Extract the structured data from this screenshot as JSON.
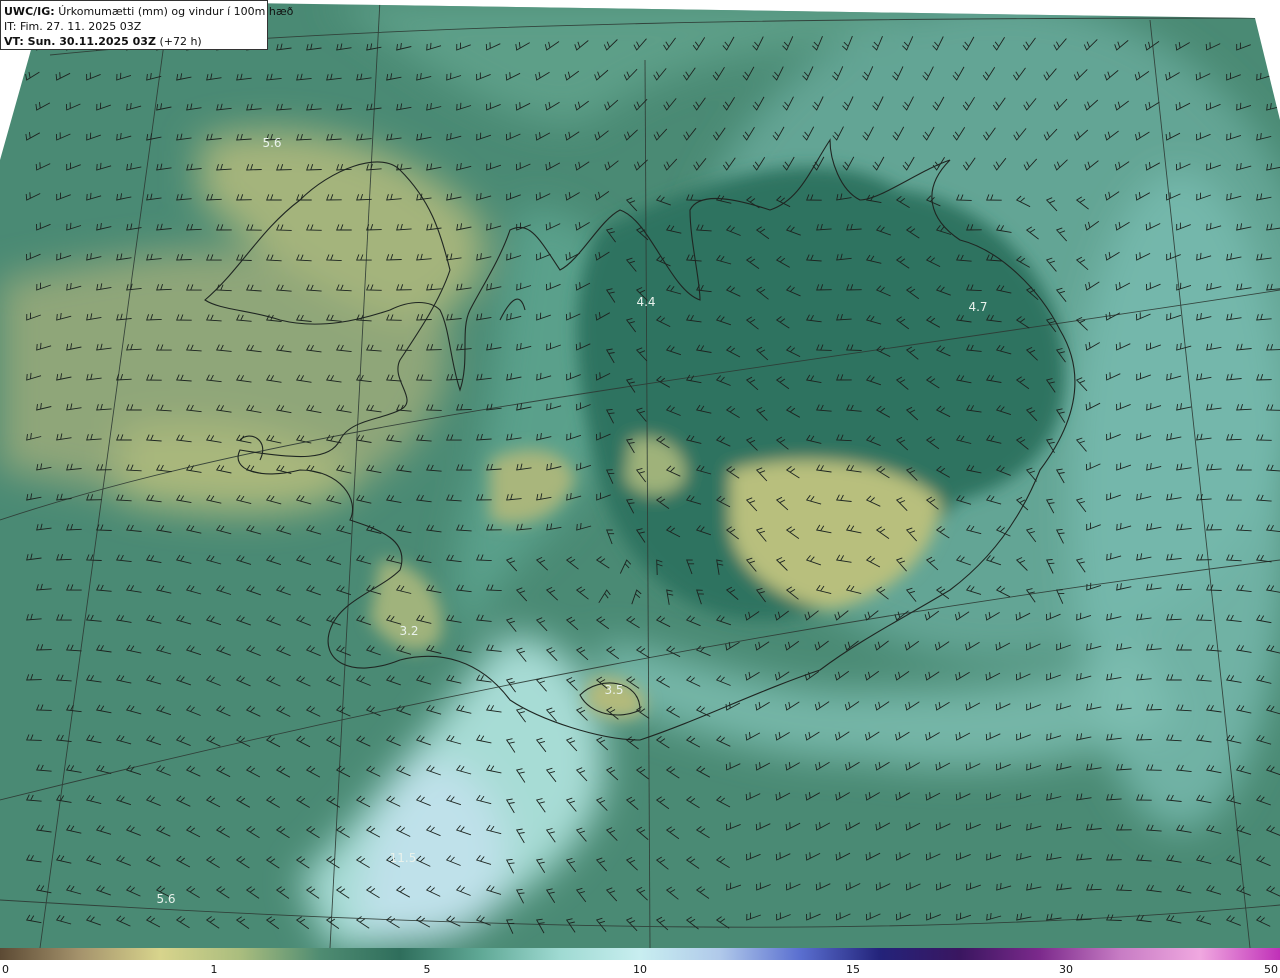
{
  "header": {
    "model": "UWC/IG:",
    "description": "Úrkomumætti (mm) og vindur í 100m hæð",
    "init_time": "IT: Fim. 27. 11. 2025 03Z",
    "valid_label": "VT: Sun. 30.11.2025 03Z",
    "lead_time": "(+72 h)"
  },
  "map_labels": [
    {
      "text": "5.6",
      "region": "northwest-sea"
    },
    {
      "text": "4.4",
      "region": "north-iceland"
    },
    {
      "text": "4.7",
      "region": "east-iceland"
    },
    {
      "text": "3.2",
      "region": "west-south-coast"
    },
    {
      "text": "3.5",
      "region": "south-coast"
    },
    {
      "text": "11.5",
      "region": "south-sea"
    },
    {
      "text": "5.6",
      "region": "southwest-sea"
    }
  ],
  "colorbar": {
    "ticks": [
      "0",
      "1",
      "5",
      "10",
      "15",
      "30",
      "50"
    ],
    "colors": [
      "#5c4a34",
      "#a5936c",
      "#d8d48c",
      "#aabd7e",
      "#4f8c72",
      "#2f6e5c",
      "#5fa895",
      "#9fdad2",
      "#c8eef0",
      "#b0c9ea",
      "#5a6fd0",
      "#23237a",
      "#3a1660",
      "#7c2a8c",
      "#c77cc4",
      "#f0a8e0",
      "#c030b8"
    ]
  },
  "colors": {
    "sea": "#4f8f78",
    "land_dry": "#2f6e5c",
    "wet": "#c8eef0",
    "yellow": "#cfcf86"
  }
}
